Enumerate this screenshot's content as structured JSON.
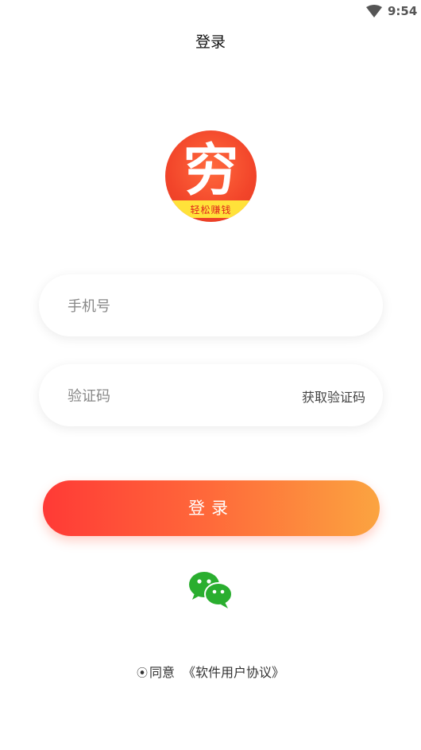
{
  "status": {
    "time": "9:54",
    "wifi_icon": "wifi-icon"
  },
  "header": {
    "title": "登录"
  },
  "logo": {
    "glyph": "穷",
    "slogan": "轻松赚钱"
  },
  "form": {
    "phone_placeholder": "手机号",
    "code_placeholder": "验证码",
    "get_code_label": "获取验证码",
    "login_label": "登录"
  },
  "social": {
    "wechat_icon": "wechat-icon"
  },
  "agreement": {
    "radio_glyph": "⦿",
    "agree_label": "同意",
    "link_label": "《软件用户协议》"
  },
  "colors": {
    "accent_start": "#ff3a36",
    "accent_end": "#fba440",
    "wechat_green": "#2aae2f"
  }
}
